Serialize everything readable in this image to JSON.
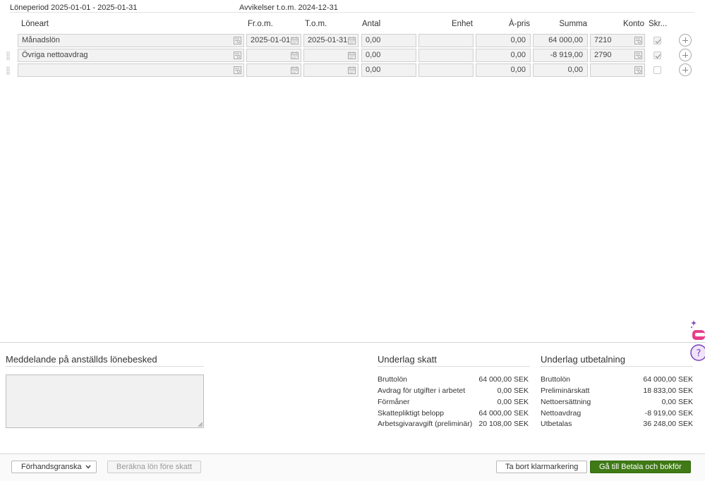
{
  "period": {
    "label": "Löneperiod 2025-01-01 - 2025-01-31",
    "deviations": "Avvikelser t.o.m. 2024-12-31"
  },
  "columns": {
    "loneart": "Löneart",
    "from": "Fr.o.m.",
    "to": "T.o.m.",
    "antal": "Antal",
    "enhet": "Enhet",
    "apris": "À-pris",
    "summa": "Summa",
    "konto": "Konto",
    "skr": "Skr..."
  },
  "rows": [
    {
      "loneart": "Månadslön",
      "from": "2025-01-01",
      "to": "2025-01-31",
      "antal": "0,00",
      "enhet": "",
      "apris": "0,00",
      "summa": "64 000,00",
      "konto": "7210",
      "checked": true
    },
    {
      "loneart": "Övriga nettoavdrag",
      "from": "",
      "to": "",
      "antal": "0,00",
      "enhet": "",
      "apris": "0,00",
      "summa": "-8 919,00",
      "konto": "2790",
      "checked": true
    },
    {
      "loneart": "",
      "from": "",
      "to": "",
      "antal": "0,00",
      "enhet": "",
      "apris": "0,00",
      "summa": "0,00",
      "konto": "",
      "checked": false
    }
  ],
  "message": {
    "title": "Meddelande på anställds lönebesked",
    "value": ""
  },
  "underlag_skatt": {
    "title": "Underlag skatt",
    "items": [
      {
        "label": "Bruttolön",
        "value": "64 000,00 SEK"
      },
      {
        "label": "Avdrag för utgifter i arbetet",
        "value": "0,00 SEK"
      },
      {
        "label": "Förmåner",
        "value": "0,00 SEK"
      },
      {
        "label": "Skattepliktigt belopp",
        "value": "64 000,00 SEK"
      },
      {
        "label": "Arbetsgivaravgift (preliminär)",
        "value": "20 108,00 SEK"
      }
    ]
  },
  "underlag_utbetalning": {
    "title": "Underlag utbetalning",
    "items": [
      {
        "label": "Bruttolön",
        "value": "64 000,00 SEK"
      },
      {
        "label": "Preliminärskatt",
        "value": "18 833,00 SEK"
      },
      {
        "label": "Nettoersättning",
        "value": "0,00 SEK"
      },
      {
        "label": "Nettoavdrag",
        "value": "-8 919,00 SEK"
      },
      {
        "label": "Utbetalas",
        "value": "36 248,00 SEK"
      }
    ]
  },
  "footer": {
    "preview": "Förhandsgranska",
    "calculate": "Beräkna lön före skatt",
    "remove_mark": "Ta bort klarmarkering",
    "go_pay": "Gå till Betala och bokför"
  },
  "colors": {
    "primary": "#3f7a16",
    "helper_pink": "#e83e8c",
    "helper_purple": "#7a3fb8"
  },
  "icons": {
    "lookup": "lookup-icon",
    "calendar": "calendar-icon",
    "add_row": "plus-circle-icon",
    "drag": "drag-handle-icon",
    "dropdown": "chevron-down-icon",
    "help": "help-icon"
  }
}
